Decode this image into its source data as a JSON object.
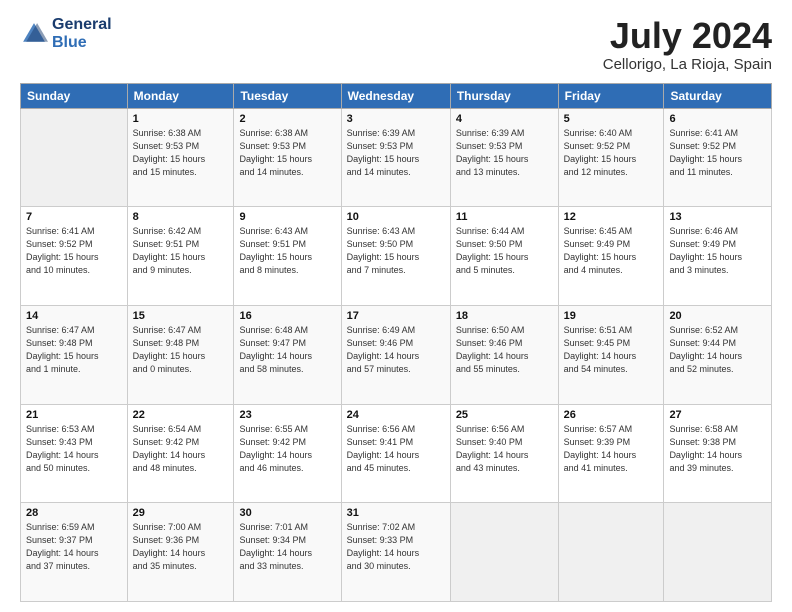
{
  "logo": {
    "text_general": "General",
    "text_blue": "Blue"
  },
  "title": "July 2024",
  "location": "Cellorigo, La Rioja, Spain",
  "headers": [
    "Sunday",
    "Monday",
    "Tuesday",
    "Wednesday",
    "Thursday",
    "Friday",
    "Saturday"
  ],
  "weeks": [
    [
      {
        "day": "",
        "lines": []
      },
      {
        "day": "1",
        "lines": [
          "Sunrise: 6:38 AM",
          "Sunset: 9:53 PM",
          "Daylight: 15 hours",
          "and 15 minutes."
        ]
      },
      {
        "day": "2",
        "lines": [
          "Sunrise: 6:38 AM",
          "Sunset: 9:53 PM",
          "Daylight: 15 hours",
          "and 14 minutes."
        ]
      },
      {
        "day": "3",
        "lines": [
          "Sunrise: 6:39 AM",
          "Sunset: 9:53 PM",
          "Daylight: 15 hours",
          "and 14 minutes."
        ]
      },
      {
        "day": "4",
        "lines": [
          "Sunrise: 6:39 AM",
          "Sunset: 9:53 PM",
          "Daylight: 15 hours",
          "and 13 minutes."
        ]
      },
      {
        "day": "5",
        "lines": [
          "Sunrise: 6:40 AM",
          "Sunset: 9:52 PM",
          "Daylight: 15 hours",
          "and 12 minutes."
        ]
      },
      {
        "day": "6",
        "lines": [
          "Sunrise: 6:41 AM",
          "Sunset: 9:52 PM",
          "Daylight: 15 hours",
          "and 11 minutes."
        ]
      }
    ],
    [
      {
        "day": "7",
        "lines": [
          "Sunrise: 6:41 AM",
          "Sunset: 9:52 PM",
          "Daylight: 15 hours",
          "and 10 minutes."
        ]
      },
      {
        "day": "8",
        "lines": [
          "Sunrise: 6:42 AM",
          "Sunset: 9:51 PM",
          "Daylight: 15 hours",
          "and 9 minutes."
        ]
      },
      {
        "day": "9",
        "lines": [
          "Sunrise: 6:43 AM",
          "Sunset: 9:51 PM",
          "Daylight: 15 hours",
          "and 8 minutes."
        ]
      },
      {
        "day": "10",
        "lines": [
          "Sunrise: 6:43 AM",
          "Sunset: 9:50 PM",
          "Daylight: 15 hours",
          "and 7 minutes."
        ]
      },
      {
        "day": "11",
        "lines": [
          "Sunrise: 6:44 AM",
          "Sunset: 9:50 PM",
          "Daylight: 15 hours",
          "and 5 minutes."
        ]
      },
      {
        "day": "12",
        "lines": [
          "Sunrise: 6:45 AM",
          "Sunset: 9:49 PM",
          "Daylight: 15 hours",
          "and 4 minutes."
        ]
      },
      {
        "day": "13",
        "lines": [
          "Sunrise: 6:46 AM",
          "Sunset: 9:49 PM",
          "Daylight: 15 hours",
          "and 3 minutes."
        ]
      }
    ],
    [
      {
        "day": "14",
        "lines": [
          "Sunrise: 6:47 AM",
          "Sunset: 9:48 PM",
          "Daylight: 15 hours",
          "and 1 minute."
        ]
      },
      {
        "day": "15",
        "lines": [
          "Sunrise: 6:47 AM",
          "Sunset: 9:48 PM",
          "Daylight: 15 hours",
          "and 0 minutes."
        ]
      },
      {
        "day": "16",
        "lines": [
          "Sunrise: 6:48 AM",
          "Sunset: 9:47 PM",
          "Daylight: 14 hours",
          "and 58 minutes."
        ]
      },
      {
        "day": "17",
        "lines": [
          "Sunrise: 6:49 AM",
          "Sunset: 9:46 PM",
          "Daylight: 14 hours",
          "and 57 minutes."
        ]
      },
      {
        "day": "18",
        "lines": [
          "Sunrise: 6:50 AM",
          "Sunset: 9:46 PM",
          "Daylight: 14 hours",
          "and 55 minutes."
        ]
      },
      {
        "day": "19",
        "lines": [
          "Sunrise: 6:51 AM",
          "Sunset: 9:45 PM",
          "Daylight: 14 hours",
          "and 54 minutes."
        ]
      },
      {
        "day": "20",
        "lines": [
          "Sunrise: 6:52 AM",
          "Sunset: 9:44 PM",
          "Daylight: 14 hours",
          "and 52 minutes."
        ]
      }
    ],
    [
      {
        "day": "21",
        "lines": [
          "Sunrise: 6:53 AM",
          "Sunset: 9:43 PM",
          "Daylight: 14 hours",
          "and 50 minutes."
        ]
      },
      {
        "day": "22",
        "lines": [
          "Sunrise: 6:54 AM",
          "Sunset: 9:42 PM",
          "Daylight: 14 hours",
          "and 48 minutes."
        ]
      },
      {
        "day": "23",
        "lines": [
          "Sunrise: 6:55 AM",
          "Sunset: 9:42 PM",
          "Daylight: 14 hours",
          "and 46 minutes."
        ]
      },
      {
        "day": "24",
        "lines": [
          "Sunrise: 6:56 AM",
          "Sunset: 9:41 PM",
          "Daylight: 14 hours",
          "and 45 minutes."
        ]
      },
      {
        "day": "25",
        "lines": [
          "Sunrise: 6:56 AM",
          "Sunset: 9:40 PM",
          "Daylight: 14 hours",
          "and 43 minutes."
        ]
      },
      {
        "day": "26",
        "lines": [
          "Sunrise: 6:57 AM",
          "Sunset: 9:39 PM",
          "Daylight: 14 hours",
          "and 41 minutes."
        ]
      },
      {
        "day": "27",
        "lines": [
          "Sunrise: 6:58 AM",
          "Sunset: 9:38 PM",
          "Daylight: 14 hours",
          "and 39 minutes."
        ]
      }
    ],
    [
      {
        "day": "28",
        "lines": [
          "Sunrise: 6:59 AM",
          "Sunset: 9:37 PM",
          "Daylight: 14 hours",
          "and 37 minutes."
        ]
      },
      {
        "day": "29",
        "lines": [
          "Sunrise: 7:00 AM",
          "Sunset: 9:36 PM",
          "Daylight: 14 hours",
          "and 35 minutes."
        ]
      },
      {
        "day": "30",
        "lines": [
          "Sunrise: 7:01 AM",
          "Sunset: 9:34 PM",
          "Daylight: 14 hours",
          "and 33 minutes."
        ]
      },
      {
        "day": "31",
        "lines": [
          "Sunrise: 7:02 AM",
          "Sunset: 9:33 PM",
          "Daylight: 14 hours",
          "and 30 minutes."
        ]
      },
      {
        "day": "",
        "lines": []
      },
      {
        "day": "",
        "lines": []
      },
      {
        "day": "",
        "lines": []
      }
    ]
  ]
}
